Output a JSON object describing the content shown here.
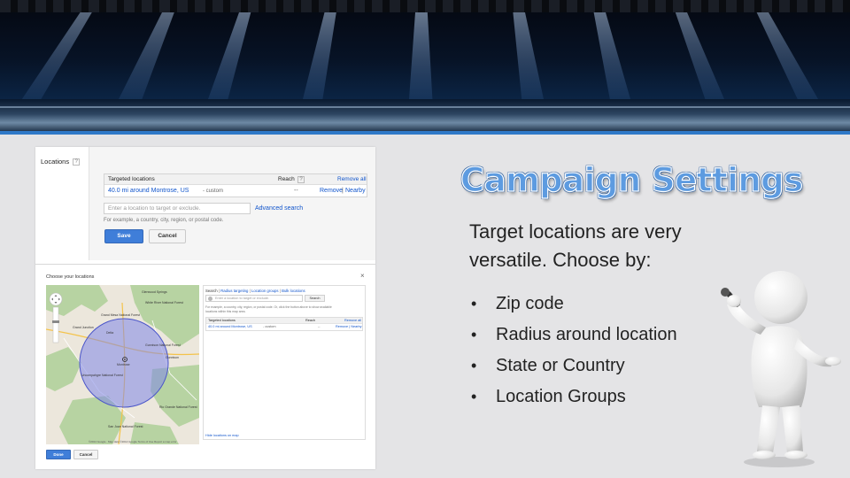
{
  "slide": {
    "title": "Campaign Settings",
    "lead": "Target locations are very versatile. Choose by:",
    "bullets": [
      "Zip code",
      "Radius around location",
      "State or Country",
      "Location Groups"
    ],
    "colors": {
      "title_fill": "#5d9be0",
      "title_outline": "#2f5f9c",
      "accent_line": "#2f79c8"
    }
  },
  "screenshot": {
    "locations_label": "Locations",
    "help_icon": "?",
    "targeted_header": "Targeted locations",
    "reach_header": "Reach",
    "remove_all": "Remove all",
    "location_name": "40.0 mi around Montrose, US",
    "location_suffix": "- custom",
    "reach_value": "--",
    "remove": "Remove",
    "separator": "|",
    "nearby": "Nearby",
    "input_placeholder": "Enter a location to target or exclude.",
    "advanced_search": "Advanced search",
    "example": "For example, a country, city, region, or postal code.",
    "save": "Save",
    "cancel": "Cancel",
    "dialog": {
      "title": "Choose your locations",
      "close": "×",
      "tabs": {
        "search": "Search",
        "radius": "Radius targeting",
        "groups": "Location groups",
        "bulk": "Bulk locations",
        "separator": "|"
      },
      "input_placeholder": "Enter a location to target or exclude.",
      "search_button": "Search",
      "example": "For example, a country, city, region, or postal code. Or, click the button above to show available locations within this map area.",
      "targeted_header": "Targeted locations",
      "reach_header": "Reach",
      "remove_all": "Remove all",
      "location_name": "40.0 mi around Montrose, US",
      "location_suffix": "- custom",
      "reach_value": "--",
      "remove_nearby": "Remove | Nearby",
      "hide_map": "Hide locations on map",
      "map_footer": "©2014 Google · Map data ©2014 Google   Terms of Use   Report a map error",
      "done": "Done",
      "cancel": "Cancel",
      "map_labels": {
        "glenwood": "Glenwood Springs",
        "grand_junction": "Grand Junction",
        "delta": "Delta",
        "montrose": "Montrose",
        "gunnison": "Gunnison",
        "uncompahgre": "Uncompahgre National Forest",
        "gunnison_nf": "Gunnison National Forest",
        "white_river": "White River National Forest",
        "grand_mesa": "Grand Mesa National Forest",
        "san_juan": "San Juan National Forest",
        "rio_grande": "Rio Grande National Forest"
      }
    }
  }
}
